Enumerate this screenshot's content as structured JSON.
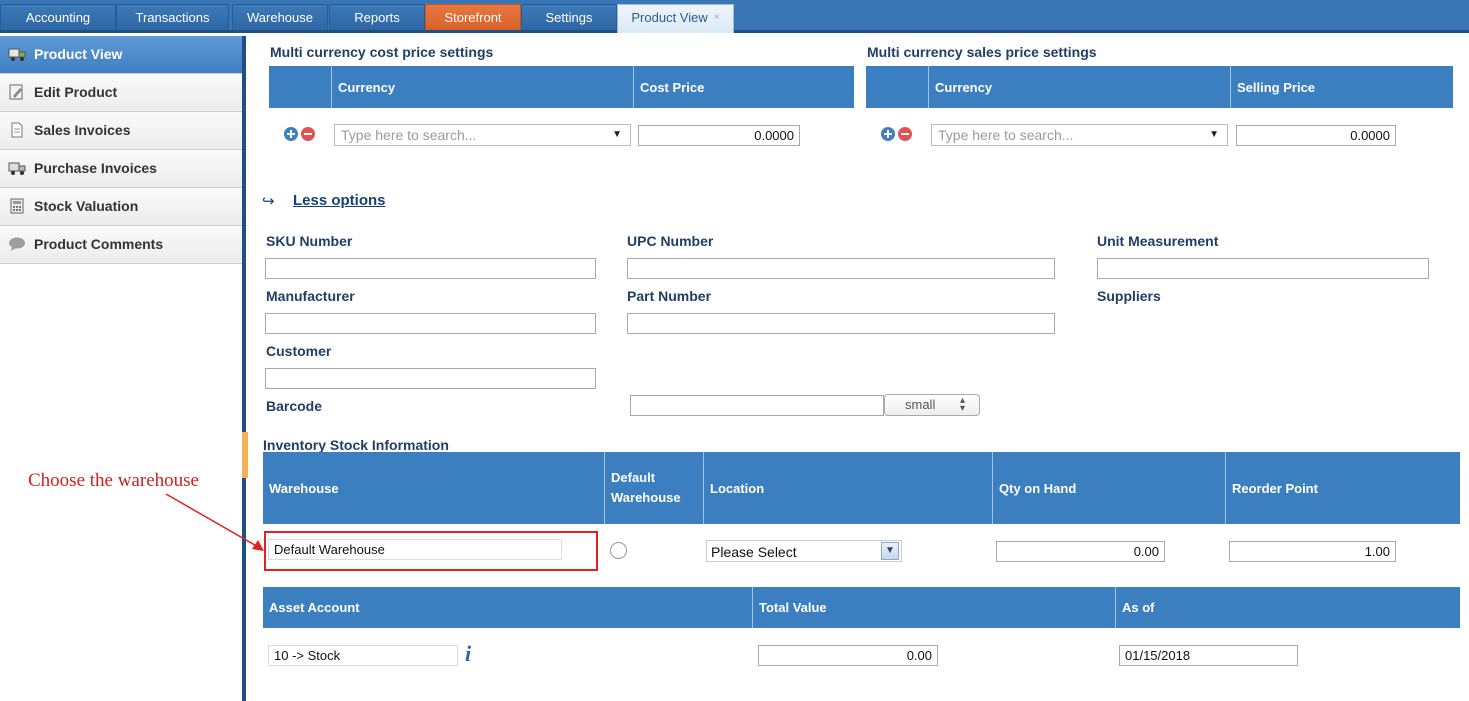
{
  "tabs": [
    {
      "label": "Accounting"
    },
    {
      "label": "Transactions"
    },
    {
      "label": "Warehouse"
    },
    {
      "label": "Reports"
    },
    {
      "label": "Storefront"
    },
    {
      "label": "Settings"
    },
    {
      "label": "Product View",
      "close": "×"
    }
  ],
  "sidebar": {
    "items": [
      {
        "label": "Product View"
      },
      {
        "label": "Edit Product"
      },
      {
        "label": "Sales Invoices"
      },
      {
        "label": "Purchase Invoices"
      },
      {
        "label": "Stock Valuation"
      },
      {
        "label": "Product Comments"
      }
    ]
  },
  "cost_section": {
    "title": "Multi currency cost price settings",
    "col_currency": "Currency",
    "col_price": "Cost Price",
    "search_placeholder": "Type here to search...",
    "price_value": "0.0000"
  },
  "sales_section": {
    "title": "Multi currency sales price settings",
    "col_currency": "Currency",
    "col_price": "Selling Price",
    "search_placeholder": "Type here to search...",
    "price_value": "0.0000"
  },
  "options": {
    "less_options": "Less options",
    "arrow": "↪"
  },
  "fields": {
    "sku_label": "SKU Number",
    "upc_label": "UPC Number",
    "unit_label": "Unit Measurement",
    "manufacturer_label": "Manufacturer",
    "part_label": "Part Number",
    "suppliers_label": "Suppliers",
    "customer_label": "Customer",
    "barcode_label": "Barcode",
    "barcode_size": "small"
  },
  "inventory": {
    "title": "Inventory Stock Information",
    "columns": {
      "warehouse": "Warehouse",
      "default_wh_1": "Default",
      "default_wh_2": "Warehouse",
      "location": "Location",
      "qty": "Qty on Hand",
      "reorder": "Reorder Point"
    },
    "row": {
      "warehouse": "Default Warehouse",
      "location": "Please Select",
      "qty": "0.00",
      "reorder": "1.00"
    }
  },
  "asset": {
    "columns": {
      "account": "Asset Account",
      "total": "Total Value",
      "as_of": "As of"
    },
    "row": {
      "account": "10 -> Stock",
      "info": "i",
      "total": "0.00",
      "as_of": "01/15/2018"
    }
  },
  "annotation": {
    "text": "Choose the warehouse",
    "color": "#d31f1f"
  },
  "colors": {
    "topbar": "#3a76b5",
    "header": "#3c7fc0",
    "storefront_tab": "#d8612a",
    "active_side": "#3f7fc2"
  }
}
